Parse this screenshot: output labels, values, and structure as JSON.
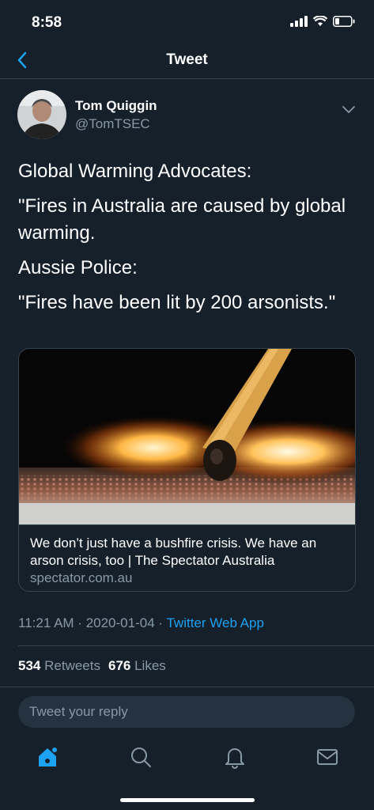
{
  "status_bar": {
    "time": "8:58"
  },
  "nav": {
    "title": "Tweet"
  },
  "author": {
    "name": "Tom Quiggin",
    "handle": "@TomTSEC"
  },
  "tweet": {
    "paragraphs": [
      "Global Warming Advocates:",
      "\"Fires in Australia are caused by global warming.",
      "Aussie Police:",
      "\"Fires have been lit by 200 arsonists.\""
    ]
  },
  "card": {
    "title": "We don’t just have a bushfire crisis. We have an arson crisis, too | The Spectator Australia",
    "domain": "spectator.com.au"
  },
  "meta": {
    "time": "11:21 AM",
    "date": "2020-01-04",
    "separator": " · ",
    "source": "Twitter Web App"
  },
  "stats": {
    "retweets_count": "534",
    "retweets_label": "Retweets",
    "likes_count": "676",
    "likes_label": "Likes"
  },
  "reply": {
    "placeholder": "Tweet your reply"
  },
  "tabs": [
    "home-icon",
    "search-icon",
    "notifications-icon",
    "messages-icon"
  ],
  "colors": {
    "background": "#15202b",
    "accent": "#1da1f2",
    "secondary_text": "#8899a6",
    "border": "#38444d"
  }
}
